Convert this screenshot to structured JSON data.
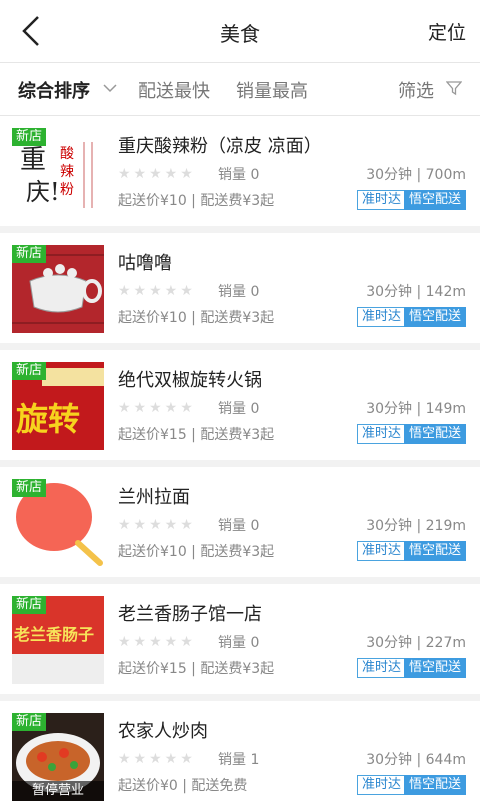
{
  "header": {
    "title": "美食",
    "locate_label": "定位"
  },
  "filters": {
    "sort": "综合排序",
    "fast": "配送最快",
    "sales": "销量最高",
    "filter": "筛选"
  },
  "colors": {
    "accent": "#3d9be0",
    "new_badge": "#2db230"
  },
  "shops": [
    {
      "name": "重庆酸辣粉（凉皮  凉面）",
      "badge": "新店",
      "sales": "销量 0",
      "time_dist": "30分钟 | 700m",
      "fees": "起送价¥10 | 配送费¥3起",
      "tag1": "准时达",
      "tag2": "悟空配送",
      "thumb_text": "重庆!"
    },
    {
      "name": "咕噜噜",
      "badge": "新店",
      "sales": "销量 0",
      "time_dist": "30分钟 | 142m",
      "fees": "起送价¥10 | 配送费¥3起",
      "tag1": "准时达",
      "tag2": "悟空配送"
    },
    {
      "name": "绝代双椒旋转火锅",
      "badge": "新店",
      "sales": "销量 0",
      "time_dist": "30分钟 | 149m",
      "fees": "起送价¥15 | 配送费¥3起",
      "tag1": "准时达",
      "tag2": "悟空配送",
      "thumb_text": "旋转"
    },
    {
      "name": "兰州拉面",
      "badge": "新店",
      "sales": "销量 0",
      "time_dist": "30分钟 | 219m",
      "fees": "起送价¥10 | 配送费¥3起",
      "tag1": "准时达",
      "tag2": "悟空配送"
    },
    {
      "name": "老兰香肠子馆一店",
      "badge": "新店",
      "sales": "销量 0",
      "time_dist": "30分钟 | 227m",
      "fees": "起送价¥15 | 配送费¥3起",
      "tag1": "准时达",
      "tag2": "悟空配送",
      "thumb_text": "老兰香肠子"
    },
    {
      "name": "农家人炒肉",
      "badge": "新店",
      "sales": "销量 1",
      "time_dist": "30分钟 | 644m",
      "fees": "起送价¥0 | 配送免费",
      "tag1": "准时达",
      "tag2": "悟空配送",
      "closed": "暂停营业"
    }
  ]
}
